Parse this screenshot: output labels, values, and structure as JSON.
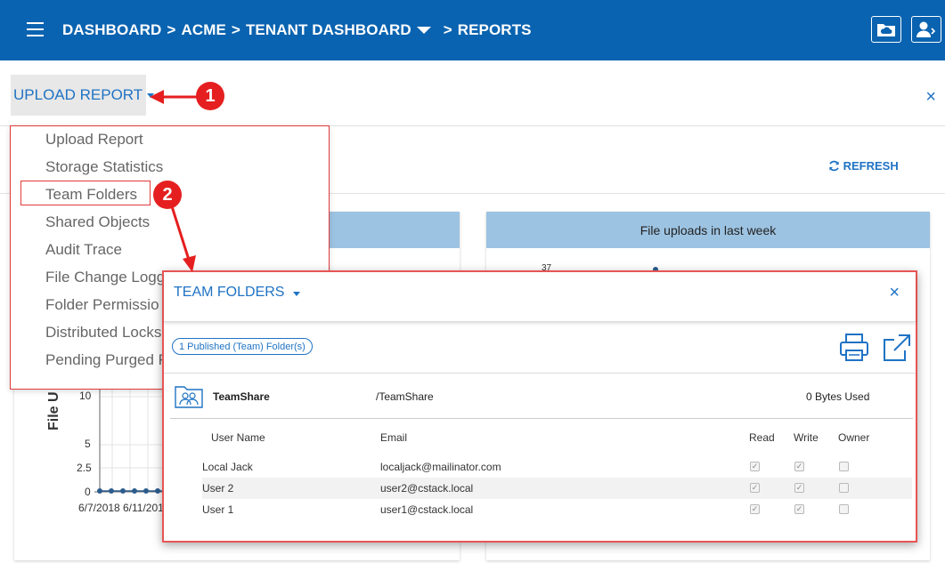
{
  "topbar": {
    "breadcrumb": {
      "dashboard": "DASHBOARD",
      "acme": "ACME",
      "tenant": "TENANT DASHBOARD",
      "reports": "REPORTS",
      "sep": ">"
    },
    "icons": [
      "menu-icon",
      "cloud-folder-icon",
      "user-profile-icon"
    ],
    "color": "#0a63b0"
  },
  "toolbar": {
    "upload_label": "UPLOAD REPORT",
    "close": "×",
    "refresh_label": "REFRESH"
  },
  "menu": {
    "items": [
      "Upload Report",
      "Storage Statistics",
      "Team Folders",
      "Shared Objects",
      "Audit Trace",
      "File Change Logg",
      "Folder Permissio",
      "Distributed Locks",
      "Pending Purged F"
    ],
    "highlighted": "Team Folders"
  },
  "annotations": {
    "one": "1",
    "two": "2",
    "color": "#e51f1f"
  },
  "cards": {
    "uploads_title": "File uploads in last week",
    "left_axis_title": "File U",
    "y_ticks": [
      "10",
      "5",
      "2.5",
      "0"
    ],
    "x_ticks": [
      "6/7/2018",
      "6/11/201"
    ],
    "right_tick": "37"
  },
  "modal": {
    "title": "TEAM FOLDERS",
    "close": "×",
    "badge": "1 Published (Team) Folder(s)",
    "folder": {
      "name": "TeamShare",
      "path": "/TeamShare",
      "used": "0 Bytes Used"
    },
    "columns": {
      "user": "User Name",
      "email": "Email",
      "read": "Read",
      "write": "Write",
      "owner": "Owner"
    },
    "rows": [
      {
        "user": "Local Jack",
        "email": "localjack@mailinator.com",
        "read": true,
        "write": true,
        "owner": false
      },
      {
        "user": "User 2",
        "email": "user2@cstack.local",
        "read": true,
        "write": true,
        "owner": false
      },
      {
        "user": "User 1",
        "email": "user1@cstack.local",
        "read": true,
        "write": true,
        "owner": false
      }
    ],
    "border_color": "#e85555"
  }
}
